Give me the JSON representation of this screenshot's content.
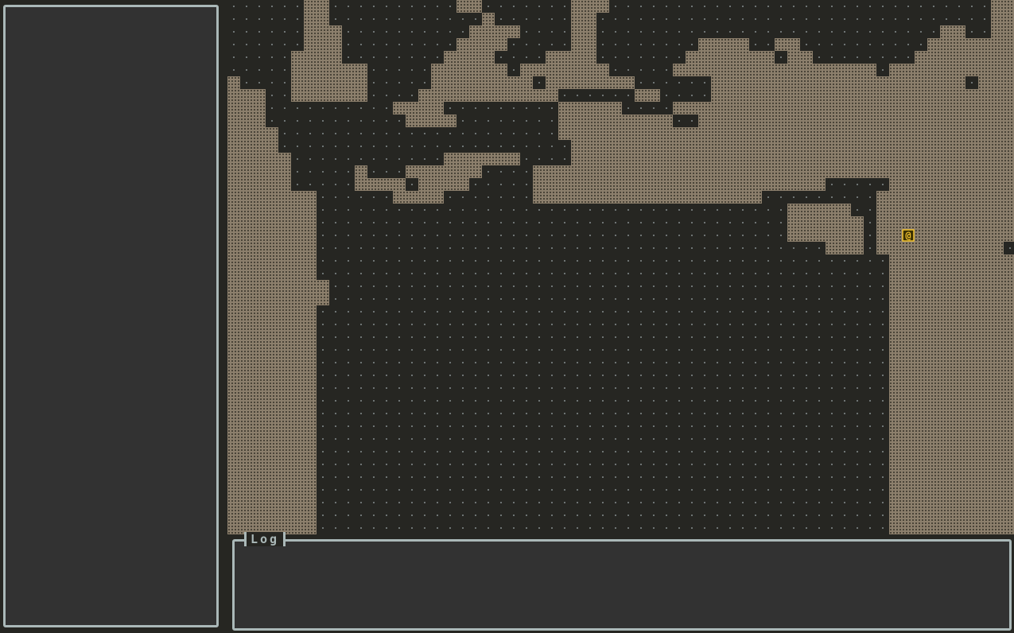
{
  "colors": {
    "background": "#262622",
    "panel": "#323232",
    "panel_border": "#aab8b8",
    "floor": "#262622",
    "floor_dot": "#6e7474",
    "wall": "#8c7f6c",
    "wall_pattern": "#4a4438",
    "player": "#f2c230",
    "player_bg": "#3a3000"
  },
  "side_panel": {
    "contents": []
  },
  "log": {
    "title": "Log",
    "messages": []
  },
  "player": {
    "glyph": "@",
    "cell": [
      53,
      18
    ]
  },
  "map": {
    "cell_size": 16,
    "cols": 62,
    "rows": 42,
    "legend": {
      "#": "wall",
      ".": "floor"
    },
    "tiles": [
      "......##..........##.......###..............................##",
      "......##............#......##...............................##",
      "......###..........####....##...........................##..##",
      "......###.........####.....##........####..##..........#######",
      ".....####........####....####.......#######.##........########",
      ".....######.....######.#######.....################.##########",
      "#....######.....########.#######......####################.###",
      "###..######....###########......##....########################",
      "###..........####.........#####....###########################",
      "###...........####........#########..#########################",
      "####......................####################################",
      "####.......................###################################",
      "#####............######....###################################",
      "#####.....#...######....######################################",
      "#####.....####.####.....#######################.....##########",
      "#######......####.......##################.........###########",
      "#######.....................................#####..###########",
      "#######.....................................######.###########",
      "#######.....................................######.###########",
      "#######........................................###.##########",
      "#######.............................................##########",
      "#######.............................................##########",
      "########............................................##########",
      "########............................................##########",
      "#######.............................................##########",
      "#######.............................................##########",
      "#######.............................................##########",
      "#######.............................................##########",
      "#######.............................................##########",
      "#######.............................................##########",
      "#######.............................................##########",
      "#######.............................................##########",
      "#######.............................................##########",
      "#######.............................................##########",
      "#######.............................................##########",
      "#######.............................................##########",
      "#######.............................................##########",
      "#######.............................................##########",
      "#######.............................................##########",
      "#######.............................................##########",
      "#######.............................................##########",
      "#######.............................................##########"
    ]
  }
}
